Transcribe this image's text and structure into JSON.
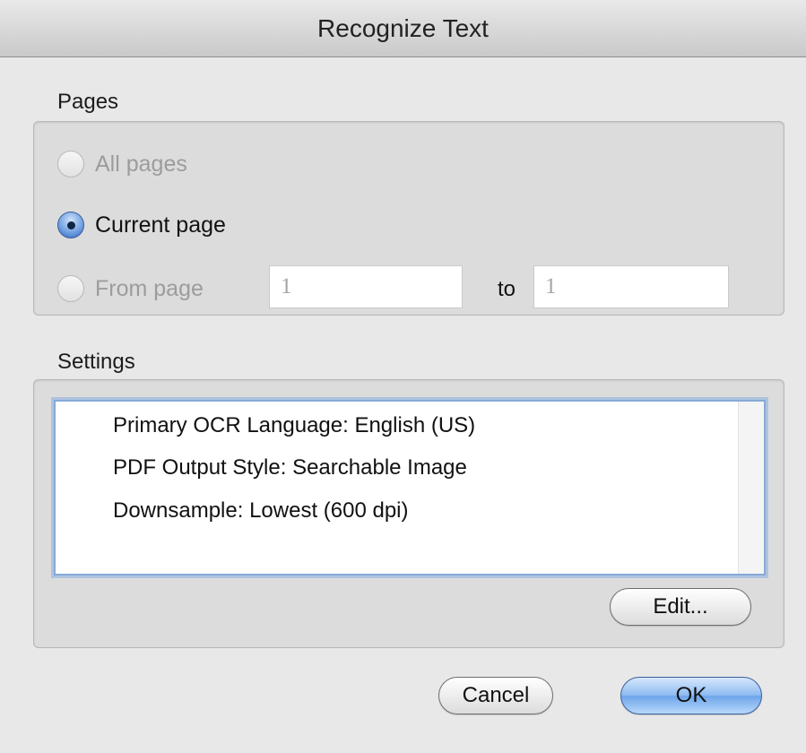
{
  "window": {
    "title": "Recognize Text"
  },
  "pages": {
    "label": "Pages",
    "options": [
      {
        "label": "All pages",
        "selected": false,
        "enabled": false
      },
      {
        "label": "Current page",
        "selected": true,
        "enabled": true
      },
      {
        "label": "From page",
        "selected": false,
        "enabled": false
      }
    ],
    "from_value": "1",
    "to_label": "to",
    "to_value": "1"
  },
  "settings": {
    "label": "Settings",
    "items": [
      "Primary OCR Language: English (US)",
      "PDF Output Style: Searchable Image",
      "Downsample: Lowest (600 dpi)"
    ],
    "edit_label": "Edit..."
  },
  "buttons": {
    "cancel": "Cancel",
    "ok": "OK"
  },
  "colors": {
    "accent": "#6ea6ea",
    "focus_ring": "#86a9d8",
    "disabled_text": "#9c9c9c"
  }
}
